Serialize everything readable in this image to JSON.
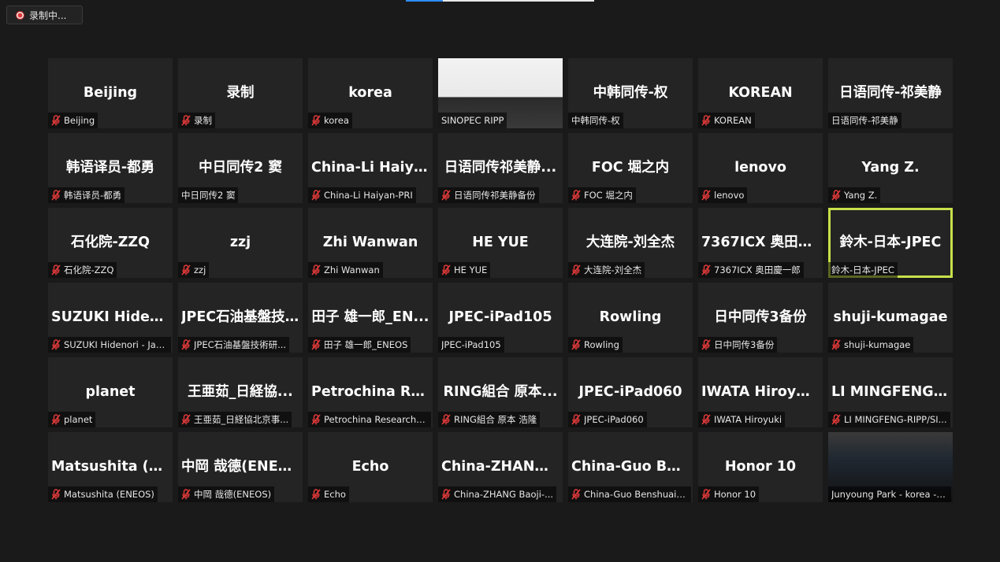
{
  "recording": {
    "label": "录制中..."
  },
  "colors": {
    "muted_mic": "#e43a3a",
    "active_border": "#c8e04a",
    "tile_bg": "#242424"
  },
  "tiles": [
    {
      "display": "Beijing",
      "label": "Beijing",
      "muted": true
    },
    {
      "display": "录制",
      "label": "录制",
      "muted": true
    },
    {
      "display": "korea",
      "label": "korea",
      "muted": true
    },
    {
      "display": "",
      "label": "SINOPEC RIPP",
      "muted": false,
      "video": "a"
    },
    {
      "display": "中韩同传-权",
      "label": "中韩同传-权",
      "muted": false
    },
    {
      "display": "KOREAN",
      "label": "KOREAN",
      "muted": true
    },
    {
      "display": "日语同传-祁美静",
      "label": "日语同传-祁美静",
      "muted": false
    },
    {
      "display": "韩语译员-都勇",
      "label": "韩语译员-都勇",
      "muted": true
    },
    {
      "display": "中日同传2 窦",
      "label": "中日同传2 窦",
      "muted": false
    },
    {
      "display": "China-Li Haiyan...",
      "label": "China-Li Haiyan-PRI",
      "muted": true
    },
    {
      "display": "日语同传祁美静...",
      "label": "日语同传祁美静备份",
      "muted": true
    },
    {
      "display": "FOC 堀之内",
      "label": "FOC 堀之内",
      "muted": true
    },
    {
      "display": "lenovo",
      "label": "lenovo",
      "muted": true
    },
    {
      "display": "Yang Z.",
      "label": "Yang Z.",
      "muted": true
    },
    {
      "display": "石化院-ZZQ",
      "label": "石化院-ZZQ",
      "muted": true
    },
    {
      "display": "zzj",
      "label": "zzj",
      "muted": true
    },
    {
      "display": "Zhi Wanwan",
      "label": "Zhi Wanwan",
      "muted": true
    },
    {
      "display": "HE YUE",
      "label": "HE YUE",
      "muted": true
    },
    {
      "display": "大连院-刘全杰",
      "label": "大连院-刘全杰",
      "muted": true
    },
    {
      "display": "7367ICX 奥田慶...",
      "label": "7367ICX 奥田慶一郎",
      "muted": true
    },
    {
      "display": "鈴木-日本-JPEC",
      "label": "鈴木-日本-JPEC",
      "muted": false,
      "active": true
    },
    {
      "display": "SUZUKI Hideno...",
      "label": "SUZUKI Hidenori - Jap...",
      "muted": true
    },
    {
      "display": "JPEC石油基盤技...",
      "label": "JPEC石油基盤技術研...",
      "muted": true
    },
    {
      "display": "田子 雄一郎_EN...",
      "label": "田子 雄一郎_ENEOS",
      "muted": true
    },
    {
      "display": "JPEC-iPad105",
      "label": "JPEC-iPad105",
      "muted": false
    },
    {
      "display": "Rowling",
      "label": "Rowling",
      "muted": true
    },
    {
      "display": "日中同传3备份",
      "label": "日中同传3备份",
      "muted": true
    },
    {
      "display": "shuji-kumagae",
      "label": "shuji-kumagae",
      "muted": true
    },
    {
      "display": "planet",
      "label": "planet",
      "muted": true
    },
    {
      "display": "王亜茹_日経協...",
      "label": "王亜茹_日経協北京事...",
      "muted": true
    },
    {
      "display": "Petrochina Rese...",
      "label": "Petrochina Research In...",
      "muted": true
    },
    {
      "display": "RING組合 原本...",
      "label": "RING組合 原本 浩隆",
      "muted": true
    },
    {
      "display": "JPEC-iPad060",
      "label": "JPEC-iPad060",
      "muted": true
    },
    {
      "display": "IWATA Hiroyuki",
      "label": "IWATA Hiroyuki",
      "muted": true
    },
    {
      "display": "LI MINGFENG-R...",
      "label": "LI MINGFENG-RIPP/SI...",
      "muted": true
    },
    {
      "display": "Matsushita (EN...",
      "label": "Matsushita (ENEOS)",
      "muted": true
    },
    {
      "display": "中岡 哉德(ENEOS)",
      "label": "中岡 哉德(ENEOS)",
      "muted": true
    },
    {
      "display": "Echo",
      "label": "Echo",
      "muted": true
    },
    {
      "display": "China-ZHANG...",
      "label": "China-ZHANG Baoji-...",
      "muted": true
    },
    {
      "display": "China-Guo Bens...",
      "label": "China-Guo Benshuai-...",
      "muted": true
    },
    {
      "display": "Honor 10",
      "label": "Honor 10",
      "muted": true
    },
    {
      "display": "",
      "label": "Junyoung Park - korea - k...",
      "muted": false,
      "video": "b"
    }
  ]
}
